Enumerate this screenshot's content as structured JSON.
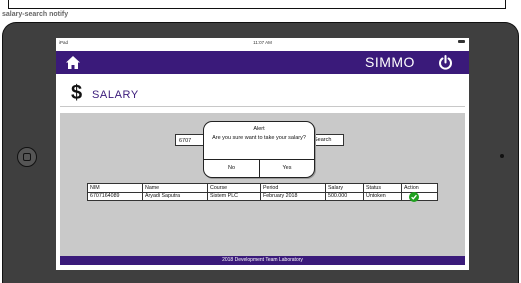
{
  "caption": "salary-search notify",
  "status_bar": {
    "carrier": "iPad",
    "time": "11:07 AM"
  },
  "header": {
    "brand": "SIMMO"
  },
  "page": {
    "title": "SALARY",
    "title_symbol": "$"
  },
  "search": {
    "value": "6707",
    "button_label": "Search"
  },
  "dialog": {
    "title": "Alert",
    "message": "Are you sure want to take your salary?",
    "no_label": "No",
    "yes_label": "Yes"
  },
  "table": {
    "headers": [
      "NIM",
      "Name",
      "Course",
      "Period",
      "Salary",
      "Status",
      "Action"
    ],
    "rows": [
      [
        "6707164089",
        "Aryadi Saputra",
        "Sistem PLC",
        "February 2018",
        "500.000",
        "Untoken"
      ]
    ]
  },
  "footer": {
    "text": "2018 Development Team Laboratory"
  },
  "colors": {
    "header_bg": "#3a1a7a",
    "content_bg": "#c9c9c9",
    "action_green": "#1fa01f"
  }
}
